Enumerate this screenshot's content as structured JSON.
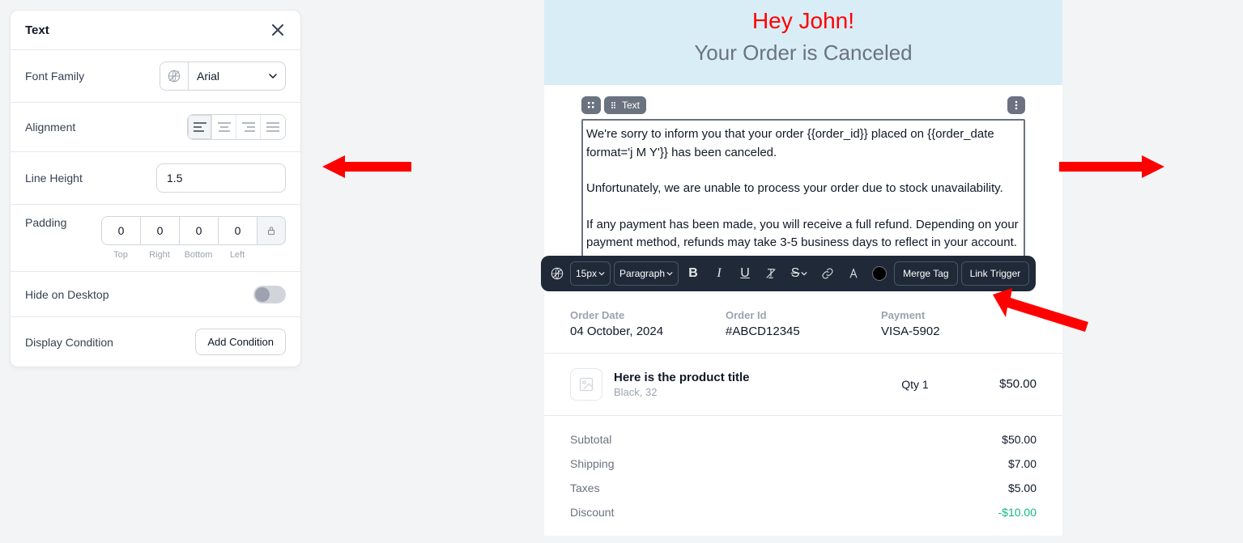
{
  "panel": {
    "title": "Text",
    "font_family_label": "Font Family",
    "font_family_value": "Arial",
    "alignment_label": "Alignment",
    "line_height_label": "Line Height",
    "line_height_value": "1.5",
    "padding_label": "Padding",
    "padding": {
      "top": "0",
      "right": "0",
      "bottom": "0",
      "left": "0"
    },
    "padding_captions": {
      "top": "Top",
      "right": "Right",
      "bottom": "Bottom",
      "left": "Left"
    },
    "hide_desktop_label": "Hide on Desktop",
    "display_condition_label": "Display Condition",
    "add_condition_label": "Add Condition"
  },
  "email": {
    "greeting": "Hey John!",
    "subheading": "Your Order is Canceled",
    "block_label": "Text",
    "p1": "We're sorry to inform you that your order {{order_id}} placed on {{order_date format='j M Y'}} has been canceled.",
    "p2": "Unfortunately, we are unable to process your order due to stock unavailability.",
    "p3": "If any payment has been made, you will receive a full refund. Depending on your payment method, refunds may take 3-5 business days to reflect in your account.",
    "meta": {
      "date_label": "Order Date",
      "date_value": "04 October, 2024",
      "id_label": "Order Id",
      "id_value": "#ABCD12345",
      "payment_label": "Payment",
      "payment_value": "VISA-5902"
    },
    "product": {
      "title": "Here is the product title",
      "variant": "Black, 32",
      "qty": "Qty 1",
      "price": "$50.00"
    },
    "totals": {
      "subtotal_label": "Subtotal",
      "subtotal": "$50.00",
      "shipping_label": "Shipping",
      "shipping": "$7.00",
      "taxes_label": "Taxes",
      "taxes": "$5.00",
      "discount_label": "Discount",
      "discount": "-$10.00"
    }
  },
  "rte": {
    "size": "15px",
    "style": "Paragraph",
    "merge_tag": "Merge Tag",
    "link_trigger": "Link Trigger"
  }
}
